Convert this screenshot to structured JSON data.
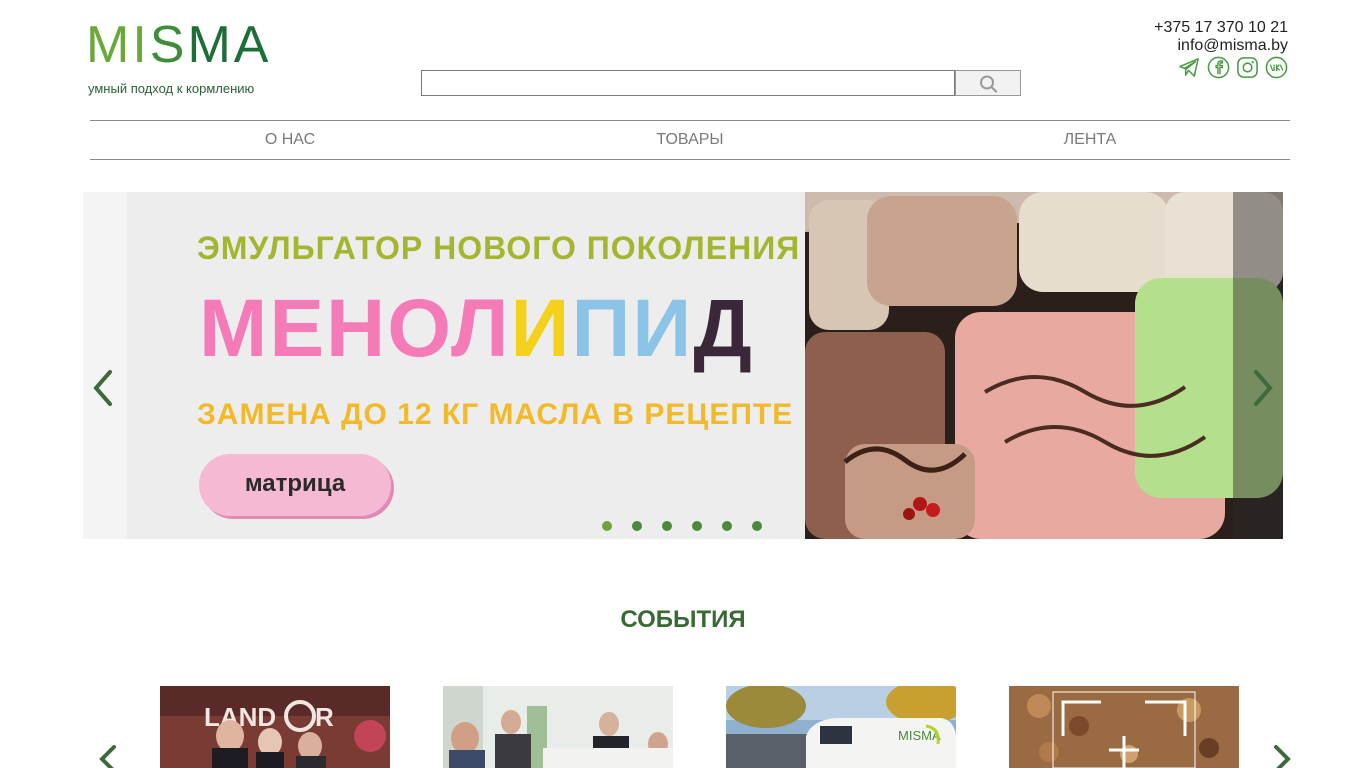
{
  "brand": {
    "logo_word": "MISMA",
    "tagline": "умный подход к кормлению"
  },
  "search": {
    "placeholder": "",
    "value": ""
  },
  "contacts": {
    "phone": "+375 17 370 10 21",
    "email": "info@misma.by"
  },
  "social_icons": [
    "telegram-icon",
    "facebook-icon",
    "instagram-icon",
    "vk-icon"
  ],
  "nav": {
    "items": [
      {
        "label": "О НАС"
      },
      {
        "label": "ТОВАРЫ"
      },
      {
        "label": "ЛЕНТА"
      }
    ]
  },
  "slider": {
    "slide_count": 6,
    "active_index": 0,
    "banner": {
      "line1": "ЭМУЛЬГАТОР НОВОГО ПОКОЛЕНИЯ",
      "title": "МЕНОЛИПИД",
      "line3": "ЗАМЕНА ДО 12 КГ МАСЛА В РЕЦЕПТЕ",
      "pill": "матрица"
    }
  },
  "events": {
    "title": "СОБЫТИЯ",
    "cards": [
      {
        "image": "event-photo-landor-booth"
      },
      {
        "image": "event-photo-meeting"
      },
      {
        "image": "event-photo-misma-van"
      },
      {
        "image": "event-photo-feed-closeup"
      }
    ]
  },
  "colors": {
    "brand_green": "#6aa83a",
    "dark_green": "#3a6a33",
    "nav_text": "#7a7a7a"
  }
}
